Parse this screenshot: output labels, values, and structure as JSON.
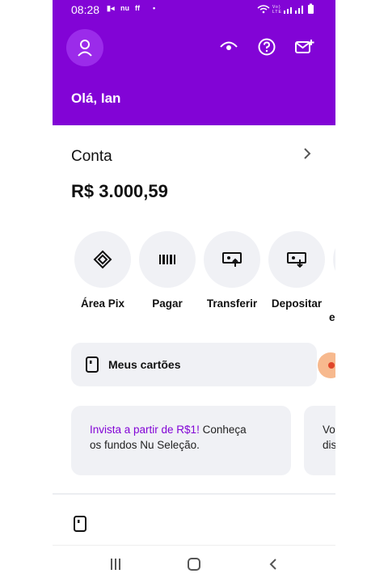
{
  "status_bar": {
    "time": "08:28",
    "indicators": "Vo) LTE",
    "right_icons": "wifi signal battery"
  },
  "header": {
    "greeting": "Olá, Ian"
  },
  "account": {
    "title": "Conta",
    "balance": "R$ 3.000,59"
  },
  "actions": [
    {
      "label": "Área Pix",
      "icon": "pix-icon"
    },
    {
      "label": "Pagar",
      "icon": "barcode-icon"
    },
    {
      "label": "Transferir",
      "icon": "transfer-icon"
    },
    {
      "label": "Depositar",
      "icon": "deposit-icon"
    }
  ],
  "cards": {
    "label": "Meus cartões"
  },
  "promos": [
    {
      "highlight": "Invista a partir de R$1!",
      "text": " Conheça os fundos Nu Seleção."
    },
    {
      "text": "Vo\ndis"
    }
  ],
  "colors": {
    "brand_purple": "#8204d6",
    "surface": "#f0f1f5"
  }
}
